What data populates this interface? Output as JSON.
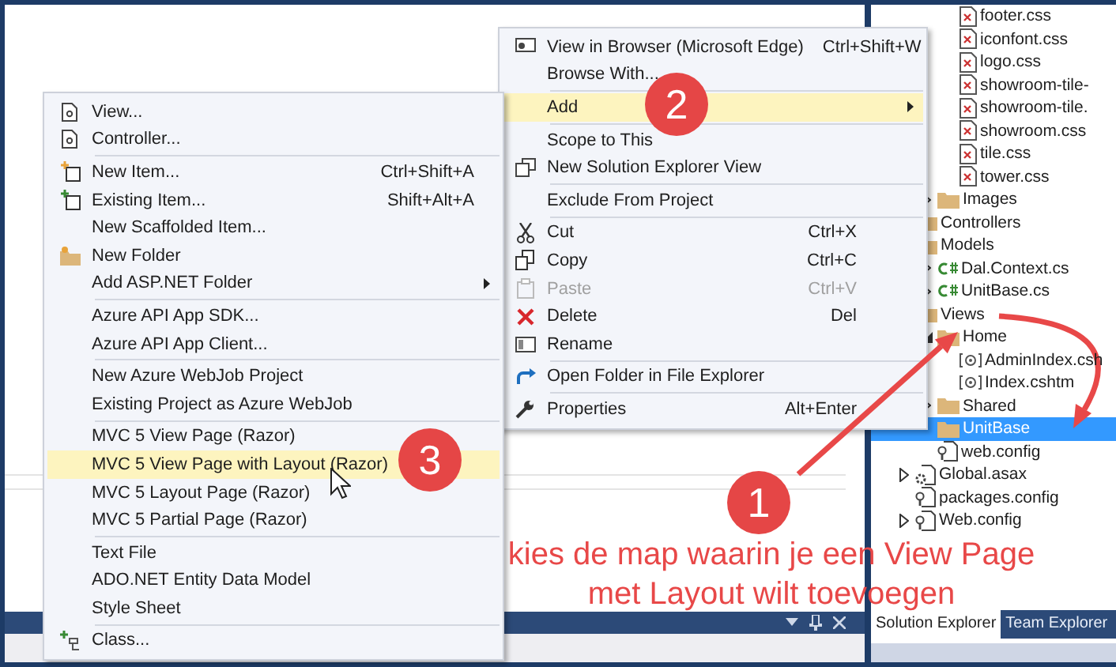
{
  "context_menu": {
    "groups": [
      [
        {
          "label": "View in Browser (Microsoft Edge)",
          "shortcut": "Ctrl+Shift+W",
          "selected": false,
          "disabled": false
        },
        {
          "label": "Browse With...",
          "selected": false,
          "disabled": false
        }
      ],
      [
        {
          "label": "Add",
          "submenu": true,
          "selected": true,
          "disabled": false
        }
      ],
      [
        {
          "label": "Scope to This",
          "selected": false,
          "disabled": false
        },
        {
          "label": "New Solution Explorer View",
          "selected": false,
          "disabled": false
        }
      ],
      [
        {
          "label": "Exclude From Project",
          "selected": false,
          "disabled": false
        }
      ],
      [
        {
          "label": "Cut",
          "shortcut": "Ctrl+X",
          "selected": false,
          "disabled": false
        },
        {
          "label": "Copy",
          "shortcut": "Ctrl+C",
          "selected": false,
          "disabled": false
        },
        {
          "label": "Paste",
          "shortcut": "Ctrl+V",
          "selected": false,
          "disabled": true
        },
        {
          "label": "Delete",
          "shortcut": "Del",
          "selected": false,
          "disabled": false
        },
        {
          "label": "Rename",
          "selected": false,
          "disabled": false
        }
      ],
      [
        {
          "label": "Open Folder in File Explorer",
          "selected": false,
          "disabled": false
        }
      ],
      [
        {
          "label": "Properties",
          "shortcut": "Alt+Enter",
          "selected": false,
          "disabled": false
        }
      ]
    ]
  },
  "add_submenu": {
    "groups": [
      [
        {
          "label": "View...",
          "selected": false
        },
        {
          "label": "Controller...",
          "selected": false
        }
      ],
      [
        {
          "label": "New Item...",
          "shortcut": "Ctrl+Shift+A",
          "selected": false
        },
        {
          "label": "Existing Item...",
          "shortcut": "Shift+Alt+A",
          "selected": false
        },
        {
          "label": "New Scaffolded Item...",
          "selected": false
        },
        {
          "label": "New Folder",
          "selected": false
        },
        {
          "label": "Add ASP.NET Folder",
          "submenu": true,
          "selected": false
        }
      ],
      [
        {
          "label": "Azure API App SDK...",
          "selected": false
        },
        {
          "label": "Azure API App Client...",
          "selected": false
        }
      ],
      [
        {
          "label": "New Azure WebJob Project",
          "selected": false
        },
        {
          "label": "Existing Project as Azure WebJob",
          "selected": false
        }
      ],
      [
        {
          "label": "MVC 5 View Page (Razor)",
          "selected": false
        },
        {
          "label": "MVC 5 View Page with Layout (Razor)",
          "selected": true
        },
        {
          "label": "MVC 5 Layout Page (Razor)",
          "selected": false
        },
        {
          "label": "MVC 5 Partial Page (Razor)",
          "selected": false
        }
      ],
      [
        {
          "label": "Text File",
          "selected": false
        },
        {
          "label": "ADO.NET Entity Data Model",
          "selected": false
        },
        {
          "label": "Style Sheet",
          "selected": false
        }
      ],
      [
        {
          "label": "Class...",
          "selected": false
        }
      ]
    ]
  },
  "solution_explorer": {
    "items": [
      {
        "children": [
          {
            "children": [
              {
                "label": "footer.css",
                "kind": "css",
                "selected": false
              },
              {
                "label": "iconfont.css",
                "kind": "css",
                "selected": false
              },
              {
                "label": "logo.css",
                "kind": "css",
                "selected": false
              },
              {
                "label": "showroom-tile-",
                "kind": "css",
                "selected": false
              },
              {
                "label": "showroom-tile.",
                "kind": "css",
                "selected": false
              },
              {
                "label": "showroom.css",
                "kind": "css",
                "selected": false
              },
              {
                "label": "tile.css",
                "kind": "css",
                "selected": false
              },
              {
                "label": "tower.css",
                "kind": "css",
                "selected": false
              }
            ]
          },
          {
            "label": "Images",
            "kind": "folder",
            "expanded": false,
            "selected": false
          }
        ]
      },
      {
        "label": "Controllers",
        "kind": "folder",
        "selected": false
      },
      {
        "label": "Models",
        "kind": "folder",
        "selected": false,
        "children": [
          {
            "label": "Dal.Context.cs",
            "kind": "cs",
            "expanded": false,
            "selected": false
          },
          {
            "label": "UnitBase.cs",
            "kind": "cs",
            "expanded": false,
            "selected": false
          }
        ]
      },
      {
        "label": "Views",
        "kind": "folder",
        "selected": false,
        "children": [
          {
            "label": "Home",
            "kind": "folder",
            "expanded": true,
            "selected": false,
            "children": [
              {
                "label": "AdminIndex.csh",
                "kind": "cshtml",
                "selected": false
              },
              {
                "label": "Index.cshtm",
                "kind": "cshtml",
                "selected": false
              }
            ]
          },
          {
            "label": "Shared",
            "kind": "folder",
            "expanded": false,
            "selected": false
          },
          {
            "label": "UnitBase",
            "kind": "folder",
            "selected": true
          },
          {
            "label": "web.config",
            "kind": "config",
            "selected": false
          }
        ]
      },
      {
        "label": "Global.asax",
        "kind": "asax",
        "expanded": false,
        "selected": false
      },
      {
        "label": "packages.config",
        "kind": "config",
        "selected": false
      },
      {
        "label": "Web.config",
        "kind": "config",
        "expanded": false,
        "selected": false
      }
    ],
    "tabs": [
      {
        "label": "Solution Explorer",
        "selected": true
      },
      {
        "label": "Team Explorer",
        "selected": false
      }
    ]
  },
  "callouts": [
    {
      "number": "1"
    },
    {
      "number": "2"
    },
    {
      "number": "3"
    }
  ],
  "instruction": [
    "kies de map waarin je een View Page",
    "met Layout wilt toevoegen"
  ]
}
